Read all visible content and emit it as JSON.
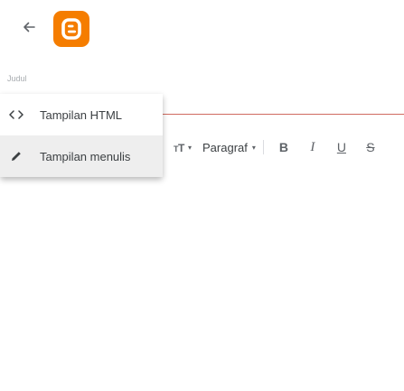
{
  "header": {
    "back_icon": "arrow-left-icon",
    "logo_icon": "blogger-logo-icon",
    "brand_color": "#f57d00"
  },
  "post": {
    "title_placeholder": "Judul",
    "title_value": ""
  },
  "mode_menu": {
    "items": [
      {
        "label": "Tampilan HTML",
        "icon": "code-brackets-icon",
        "selected": false
      },
      {
        "label": "Tampilan menulis",
        "icon": "pencil-icon",
        "selected": true
      }
    ]
  },
  "toolbar": {
    "font_size_icon": "text-size-icon",
    "paragraph_label": "Paragraf",
    "bold_label": "B",
    "italic_label": "I",
    "underline_label": "U",
    "strikethrough_label": "S"
  },
  "colors": {
    "accent_rule": "#c0392b",
    "active_item_bg": "#eeeeee"
  }
}
